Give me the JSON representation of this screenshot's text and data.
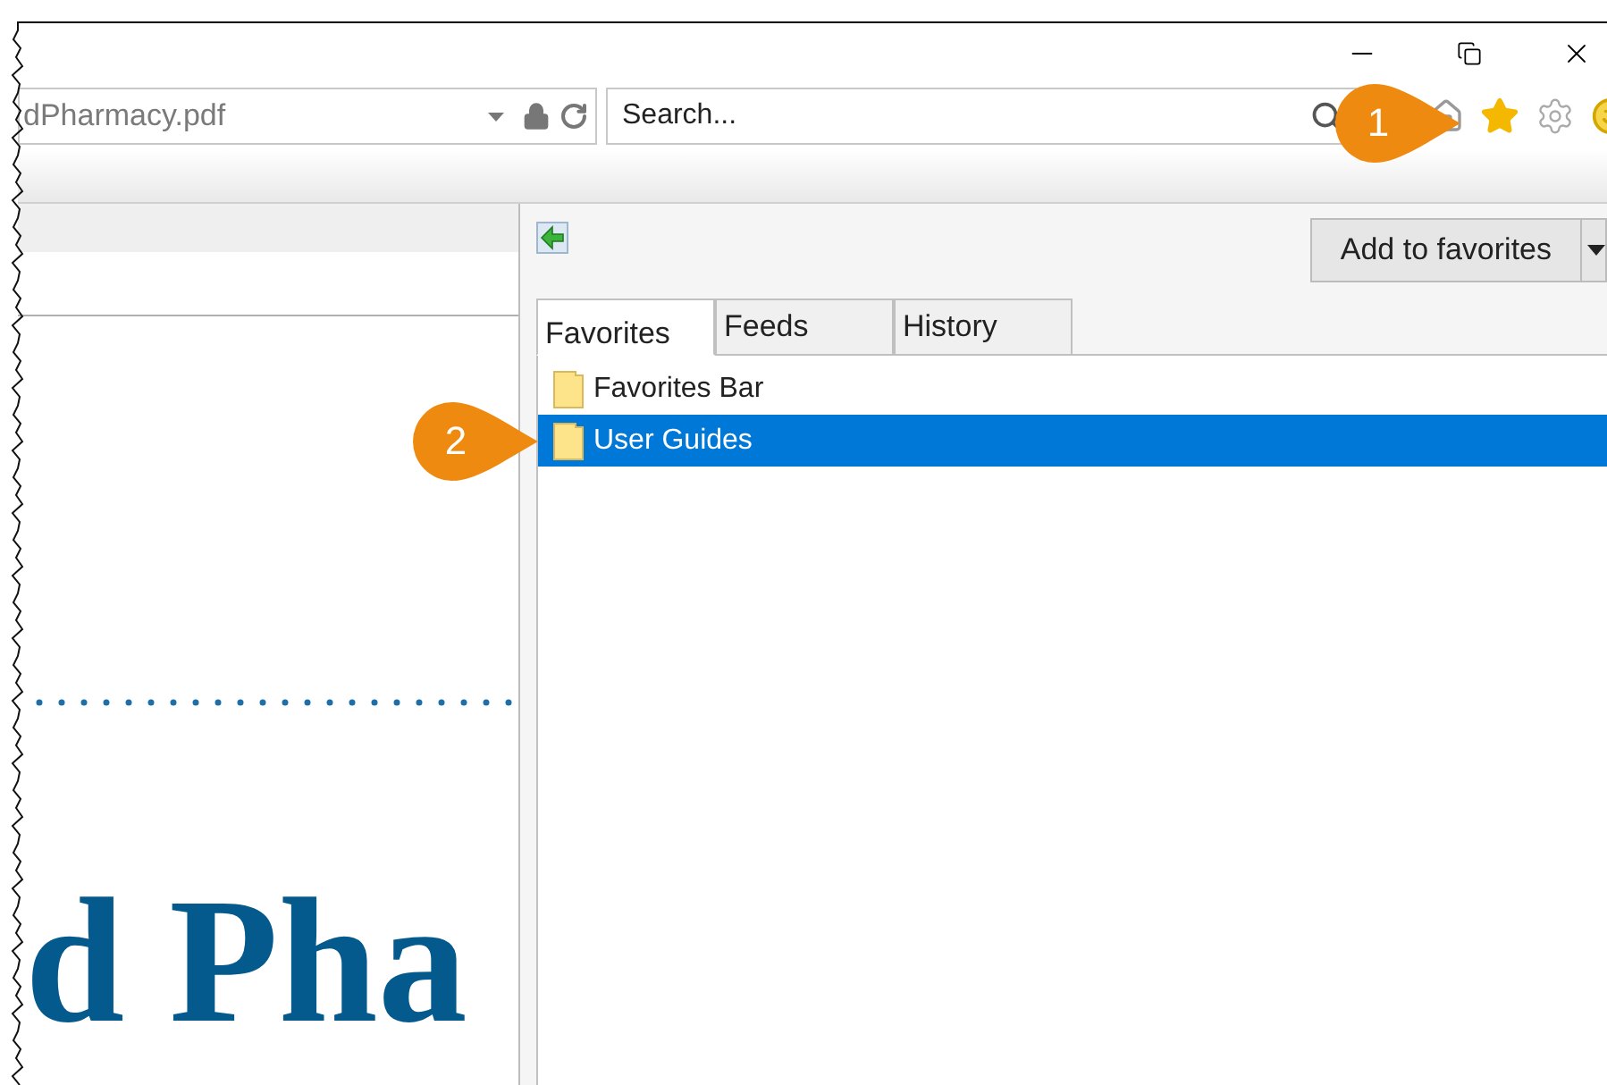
{
  "address_bar": {
    "value": "dPharmacy.pdf"
  },
  "search": {
    "placeholder": "Search..."
  },
  "document": {
    "heading": "d Pha"
  },
  "favorites_panel": {
    "add_button": "Add to favorites",
    "tabs": [
      {
        "label": "Favorites",
        "selected": true
      },
      {
        "label": "Feeds",
        "selected": false
      },
      {
        "label": "History",
        "selected": false
      }
    ],
    "items": [
      {
        "label": "Favorites Bar",
        "selected": false
      },
      {
        "label": "User Guides",
        "selected": true
      }
    ]
  },
  "callouts": [
    {
      "number": "1"
    },
    {
      "number": "2"
    }
  ]
}
